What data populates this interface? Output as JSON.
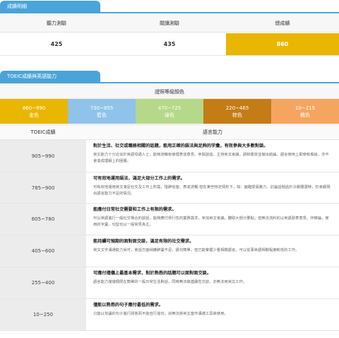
{
  "section1": {
    "tab_label": "成績明細",
    "headers": [
      "聽力測驗",
      "閱讀測驗",
      "總成績"
    ],
    "values": [
      "425",
      "435",
      "860"
    ]
  },
  "section2": {
    "tab_label": "TOEIC成績與英語能力",
    "color_header": "證照等級顏色",
    "bands": [
      {
        "range": "860~990",
        "name": "金色",
        "color": "#e9b600"
      },
      {
        "range": "730~855",
        "name": "藍色",
        "color": "#8fc3e9"
      },
      {
        "range": "470~725",
        "name": "綠色",
        "color": "#b5d98a"
      },
      {
        "range": "220~465",
        "name": "棕色",
        "color": "#c47c16"
      },
      {
        "range": "10~215",
        "name": "橘色",
        "color": "#f5a55f"
      }
    ],
    "level_headers": {
      "score": "TOEIC成績",
      "desc": "語言能力"
    },
    "rows": [
      {
        "score": "905~990",
        "title": "對於生活、社交或職務相關的話題，能用正確的語法與足夠的字彙，有效參與大多數對談。",
        "text": "英文能力十分近似於英語母語人士，能夠流暢有條理表達意見、參與談話，主持英文會議，調和衝突並做出結論，語言使用上即使有瑕疵，亦不會造成理解上的困擾。"
      },
      {
        "score": "785~900",
        "title": "可有效地運用語法，滿足大部分工作上的需求。",
        "text": "可有效地運用英文滿足社交及工作上所需，措辭恰當、表達流暢;但在某些特定情形下，如：面臨緊張壓力、討論話題過於冷僻艱澀時，仍會顯現出語言能力不足的情況。"
      },
      {
        "score": "605~780",
        "title": "能應付日常社交需要和工作上有限的需求。",
        "text": "可以英語進行一般社交場合的談話，能夠應付例行性的業務需求，參加英文會議，聽取大部分要點；但無法流利的以英語發表意見、作辯論，使用的字彙、句型也以一般常見為主。"
      },
      {
        "score": "405~600",
        "title": "能持續可預期的面對面交談，滿足有限的社交需求。",
        "text": "英文文字溝通能力尚可，會話方面稍嫌辭彙不足、語句簡單，但已能掌握少量相關語言，可以從事英語相關程度較低的工作。"
      },
      {
        "score": "255~400",
        "title": "可應付禮儀上最基本需求，對於熟悉的話題可以面對面交談。",
        "text": "語言能力僅僅侷限在簡單的一般日常生活對話，同時無法做連續性交談，亦無法用英文工作。"
      },
      {
        "score": "10~250",
        "title": "僅能以熟悉的句子應付最低的需求。",
        "text": "只能以背誦的句子進行問答而不能自行造句，尚無法將英文當作溝通工具來使用。"
      }
    ]
  }
}
